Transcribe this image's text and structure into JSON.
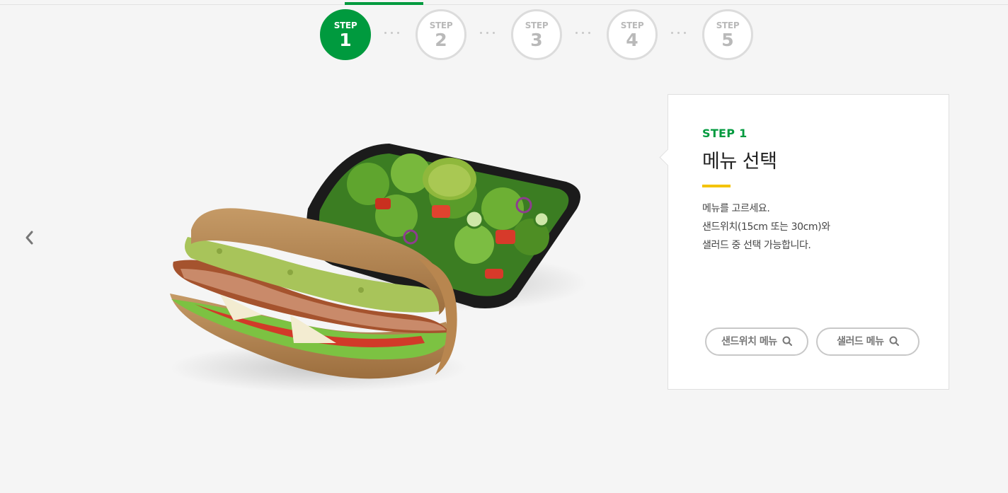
{
  "steps": [
    {
      "label": "STEP",
      "number": "1",
      "active": true
    },
    {
      "label": "STEP",
      "number": "2",
      "active": false
    },
    {
      "label": "STEP",
      "number": "3",
      "active": false
    },
    {
      "label": "STEP",
      "number": "4",
      "active": false
    },
    {
      "label": "STEP",
      "number": "5",
      "active": false
    }
  ],
  "card": {
    "step_label": "STEP 1",
    "title": "메뉴 선택",
    "description": [
      "메뉴를 고르세요.",
      "샌드위치(15cm 또는 30cm)와",
      "샐러드 중 선택 가능합니다."
    ],
    "buttons": {
      "sandwich_menu": "샌드위치 메뉴",
      "salad_menu": "샐러드 메뉴"
    }
  },
  "colors": {
    "accent_green": "#009a3e",
    "accent_yellow": "#f4c300",
    "inactive_gray": "#b9b9b9"
  },
  "icons": {
    "prev": "chevron-left-icon",
    "search": "search-icon"
  }
}
